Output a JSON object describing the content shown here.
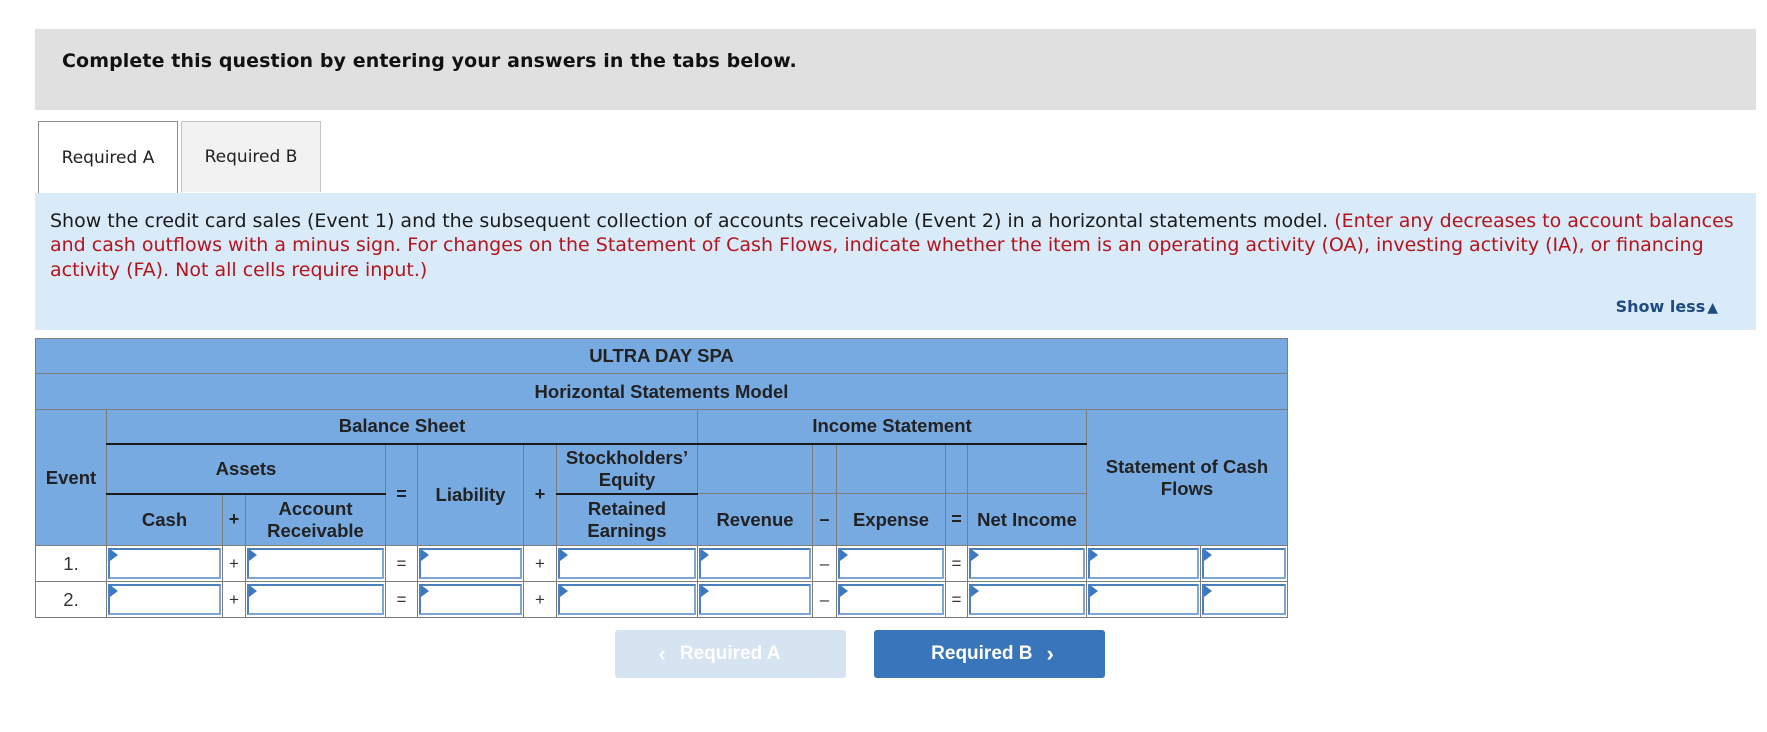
{
  "header": {
    "text": "Complete this question by entering your answers in the tabs below."
  },
  "tabs": [
    {
      "label": "Required A",
      "active": true
    },
    {
      "label": "Required B",
      "active": false
    }
  ],
  "instructions": {
    "black_text": "Show the credit card sales (Event 1) and the subsequent collection of accounts receivable (Event 2) in a horizontal statements model. ",
    "red_text": "(Enter any decreases to account balances and cash outflows with a minus sign. For changes on the Statement of Cash Flows, indicate whether the item is an operating activity (OA), investing activity (IA), or financing activity (FA). Not all cells require input.)",
    "show_less": "Show less",
    "show_less_icon": "▲"
  },
  "table": {
    "company": "ULTRA DAY SPA",
    "title": "Horizontal Statements Model",
    "event_header": "Event",
    "balance_sheet": "Balance Sheet",
    "income_statement": "Income Statement",
    "cash_flows": "Statement of Cash Flows",
    "assets": "Assets",
    "stockholders_equity": "Stockholders’ Equity",
    "columns": {
      "cash": "Cash",
      "account_receivable": "Account Receivable",
      "liability": "Liability",
      "retained_earnings": "Retained Earnings",
      "revenue": "Revenue",
      "expense": "Expense",
      "net_income": "Net Income"
    },
    "operators": {
      "plus": "+",
      "equals": "=",
      "minus": "–"
    },
    "rows": [
      {
        "event": "1.",
        "cash": "",
        "account_receivable": "",
        "liability": "",
        "retained_earnings": "",
        "revenue": "",
        "expense": "",
        "net_income": "",
        "cash_flow_amount": "",
        "cash_flow_activity": ""
      },
      {
        "event": "2.",
        "cash": "",
        "account_receivable": "",
        "liability": "",
        "retained_earnings": "",
        "revenue": "",
        "expense": "",
        "net_income": "",
        "cash_flow_amount": "",
        "cash_flow_activity": ""
      }
    ]
  },
  "nav": {
    "prev_label": "Required A",
    "next_label": "Required B",
    "prev_icon": "‹",
    "next_icon": "›"
  }
}
